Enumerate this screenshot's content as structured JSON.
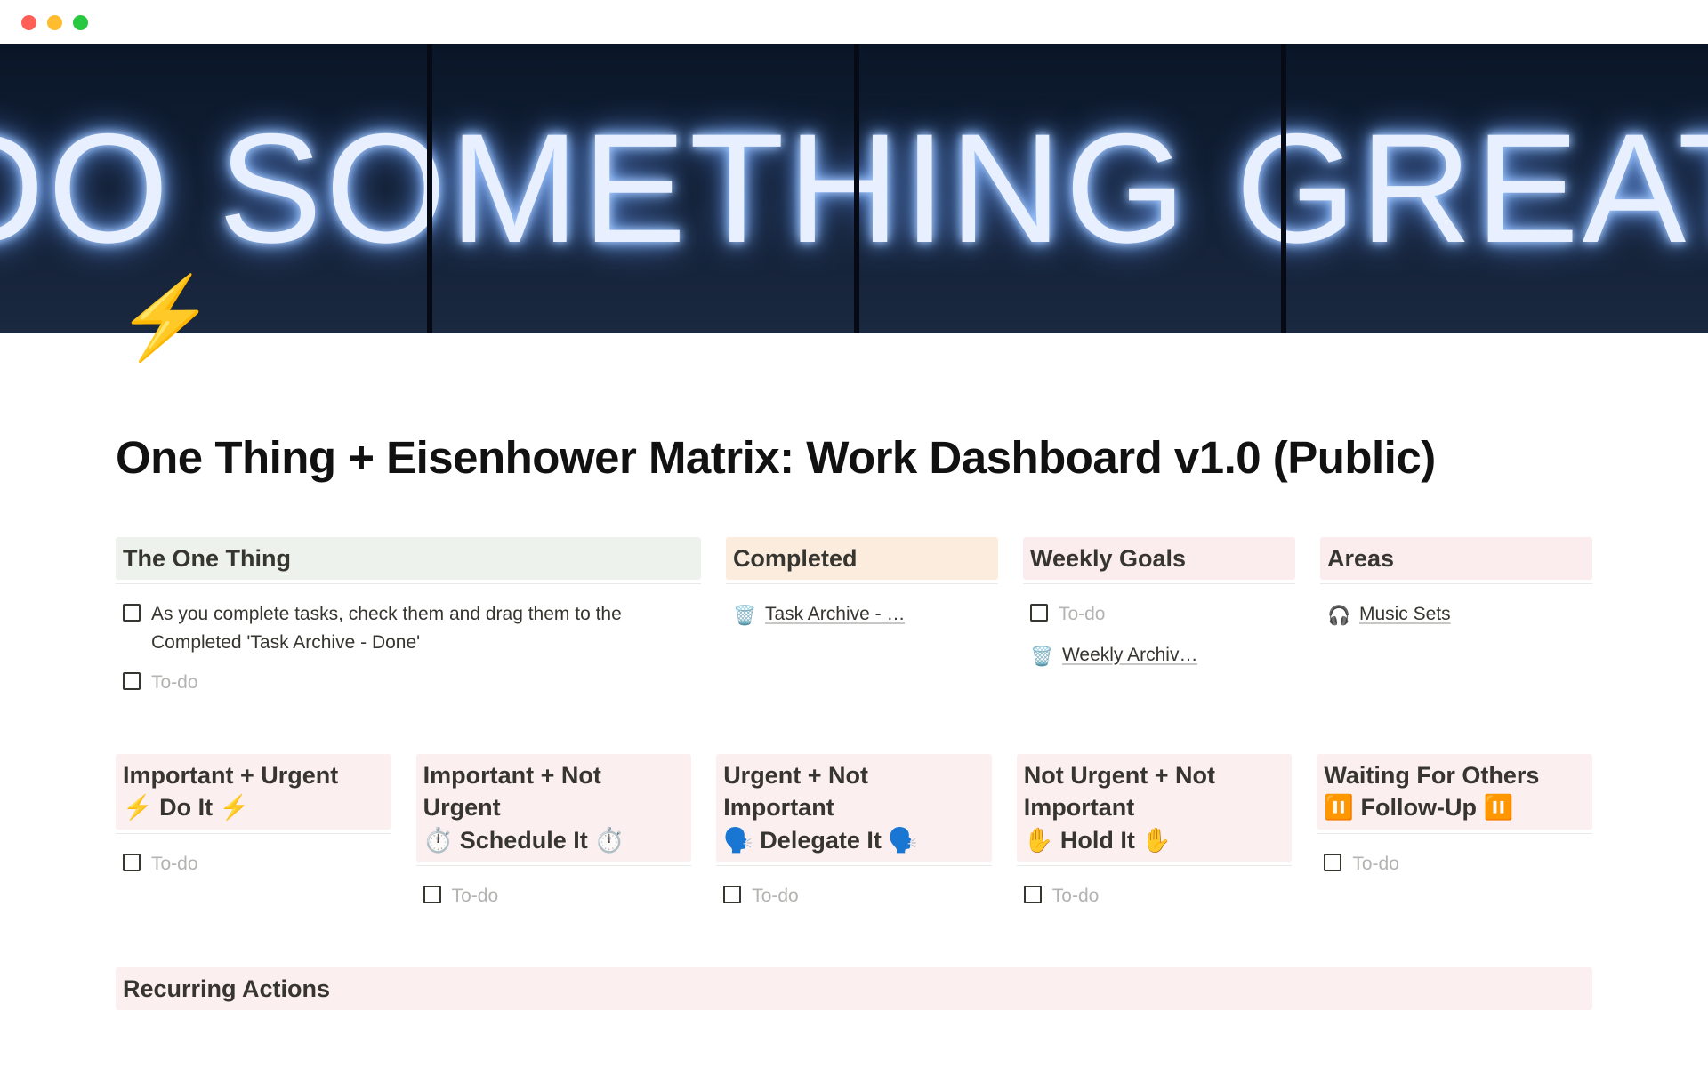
{
  "cover_text": "DO SOMETHING GREAT",
  "page_icon": "⚡",
  "page_title": "One Thing + Eisenhower Matrix: Work Dashboard v1.0 (Public)",
  "row1": {
    "one_thing": {
      "heading": "The One Thing",
      "items": [
        {
          "text": "As you complete tasks, check them and drag them to the Completed 'Task Archive - Done'",
          "placeholder": false
        },
        {
          "text": "To-do",
          "placeholder": true
        }
      ]
    },
    "completed": {
      "heading": "Completed",
      "items": [
        {
          "icon": "🗑️",
          "text": "Task Archive - …"
        }
      ]
    },
    "weekly_goals": {
      "heading": "Weekly Goals",
      "items": [
        {
          "type": "checkbox",
          "text": "To-do",
          "placeholder": true
        },
        {
          "type": "link",
          "icon": "🗑️",
          "text": "Weekly Archiv…"
        }
      ]
    },
    "areas": {
      "heading": "Areas",
      "items": [
        {
          "icon": "🎧",
          "text": "Music Sets"
        }
      ]
    }
  },
  "row2": {
    "q1": {
      "heading": "Important + Urgent\n⚡ Do It ⚡",
      "todo": "To-do"
    },
    "q2": {
      "heading": "Important + Not Urgent\n⏱️ Schedule It ⏱️",
      "todo": "To-do"
    },
    "q3": {
      "heading": "Urgent + Not Important\n🗣️ Delegate It 🗣️",
      "todo": "To-do"
    },
    "q4": {
      "heading": "Not Urgent + Not Important\n✋ Hold It ✋",
      "todo": "To-do"
    },
    "waiting": {
      "heading": "Waiting For Others\n⏸️ Follow-Up ⏸️",
      "todo": "To-do"
    }
  },
  "recurring": {
    "heading": "Recurring Actions"
  }
}
